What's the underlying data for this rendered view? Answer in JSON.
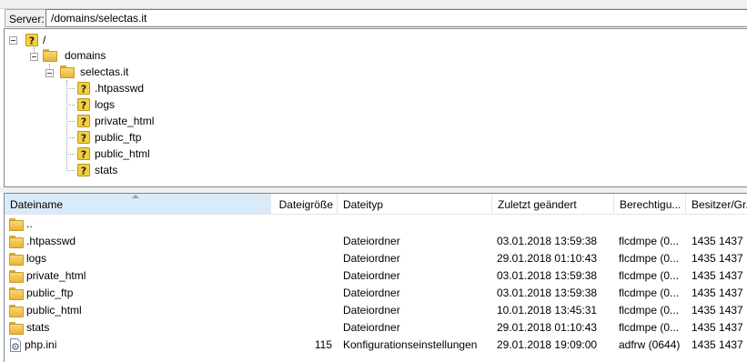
{
  "server": {
    "label": "Server:",
    "path": "/domains/selectas.it"
  },
  "tree": {
    "root": {
      "label": "/",
      "icon": "question-icon"
    },
    "domains": {
      "label": "domains",
      "icon": "folder-icon"
    },
    "selectas": {
      "label": "selectas.it",
      "icon": "folder-icon"
    },
    "children": [
      {
        "label": ".htpasswd",
        "icon": "question-icon"
      },
      {
        "label": "logs",
        "icon": "question-icon"
      },
      {
        "label": "private_html",
        "icon": "question-icon"
      },
      {
        "label": "public_ftp",
        "icon": "question-icon"
      },
      {
        "label": "public_html",
        "icon": "question-icon"
      },
      {
        "label": "stats",
        "icon": "question-icon"
      }
    ]
  },
  "list": {
    "columns": {
      "name": "Dateiname",
      "size": "Dateigröße",
      "type": "Dateityp",
      "modified": "Zuletzt geändert",
      "perms": "Berechtigu...",
      "owner": "Besitzer/Gr..."
    },
    "rows": [
      {
        "name": "..",
        "size": "",
        "type": "",
        "modified": "",
        "perms": "",
        "owner": "",
        "icon": "folder-icon"
      },
      {
        "name": ".htpasswd",
        "size": "",
        "type": "Dateiordner",
        "modified": "03.01.2018 13:59:38",
        "perms": "flcdmpe (0...",
        "owner": "1435 1437",
        "icon": "folder-icon"
      },
      {
        "name": "logs",
        "size": "",
        "type": "Dateiordner",
        "modified": "29.01.2018 01:10:43",
        "perms": "flcdmpe (0...",
        "owner": "1435 1437",
        "icon": "folder-icon"
      },
      {
        "name": "private_html",
        "size": "",
        "type": "Dateiordner",
        "modified": "03.01.2018 13:59:38",
        "perms": "flcdmpe (0...",
        "owner": "1435 1437",
        "icon": "folder-icon"
      },
      {
        "name": "public_ftp",
        "size": "",
        "type": "Dateiordner",
        "modified": "03.01.2018 13:59:38",
        "perms": "flcdmpe (0...",
        "owner": "1435 1437",
        "icon": "folder-icon"
      },
      {
        "name": "public_html",
        "size": "",
        "type": "Dateiordner",
        "modified": "10.01.2018 13:45:31",
        "perms": "flcdmpe (0...",
        "owner": "1435 1437",
        "icon": "folder-icon"
      },
      {
        "name": "stats",
        "size": "",
        "type": "Dateiordner",
        "modified": "29.01.2018 01:10:43",
        "perms": "flcdmpe (0...",
        "owner": "1435 1437",
        "icon": "folder-icon"
      },
      {
        "name": "php.ini",
        "size": "115",
        "type": "Konfigurationseinstellungen",
        "modified": "29.01.2018 19:09:00",
        "perms": "adfrw (0644)",
        "owner": "1435 1437",
        "icon": "settings-file-icon"
      }
    ]
  },
  "colors": {
    "accent": "#d9ebf9",
    "folder": "#f0c24b",
    "border": "#828790"
  }
}
